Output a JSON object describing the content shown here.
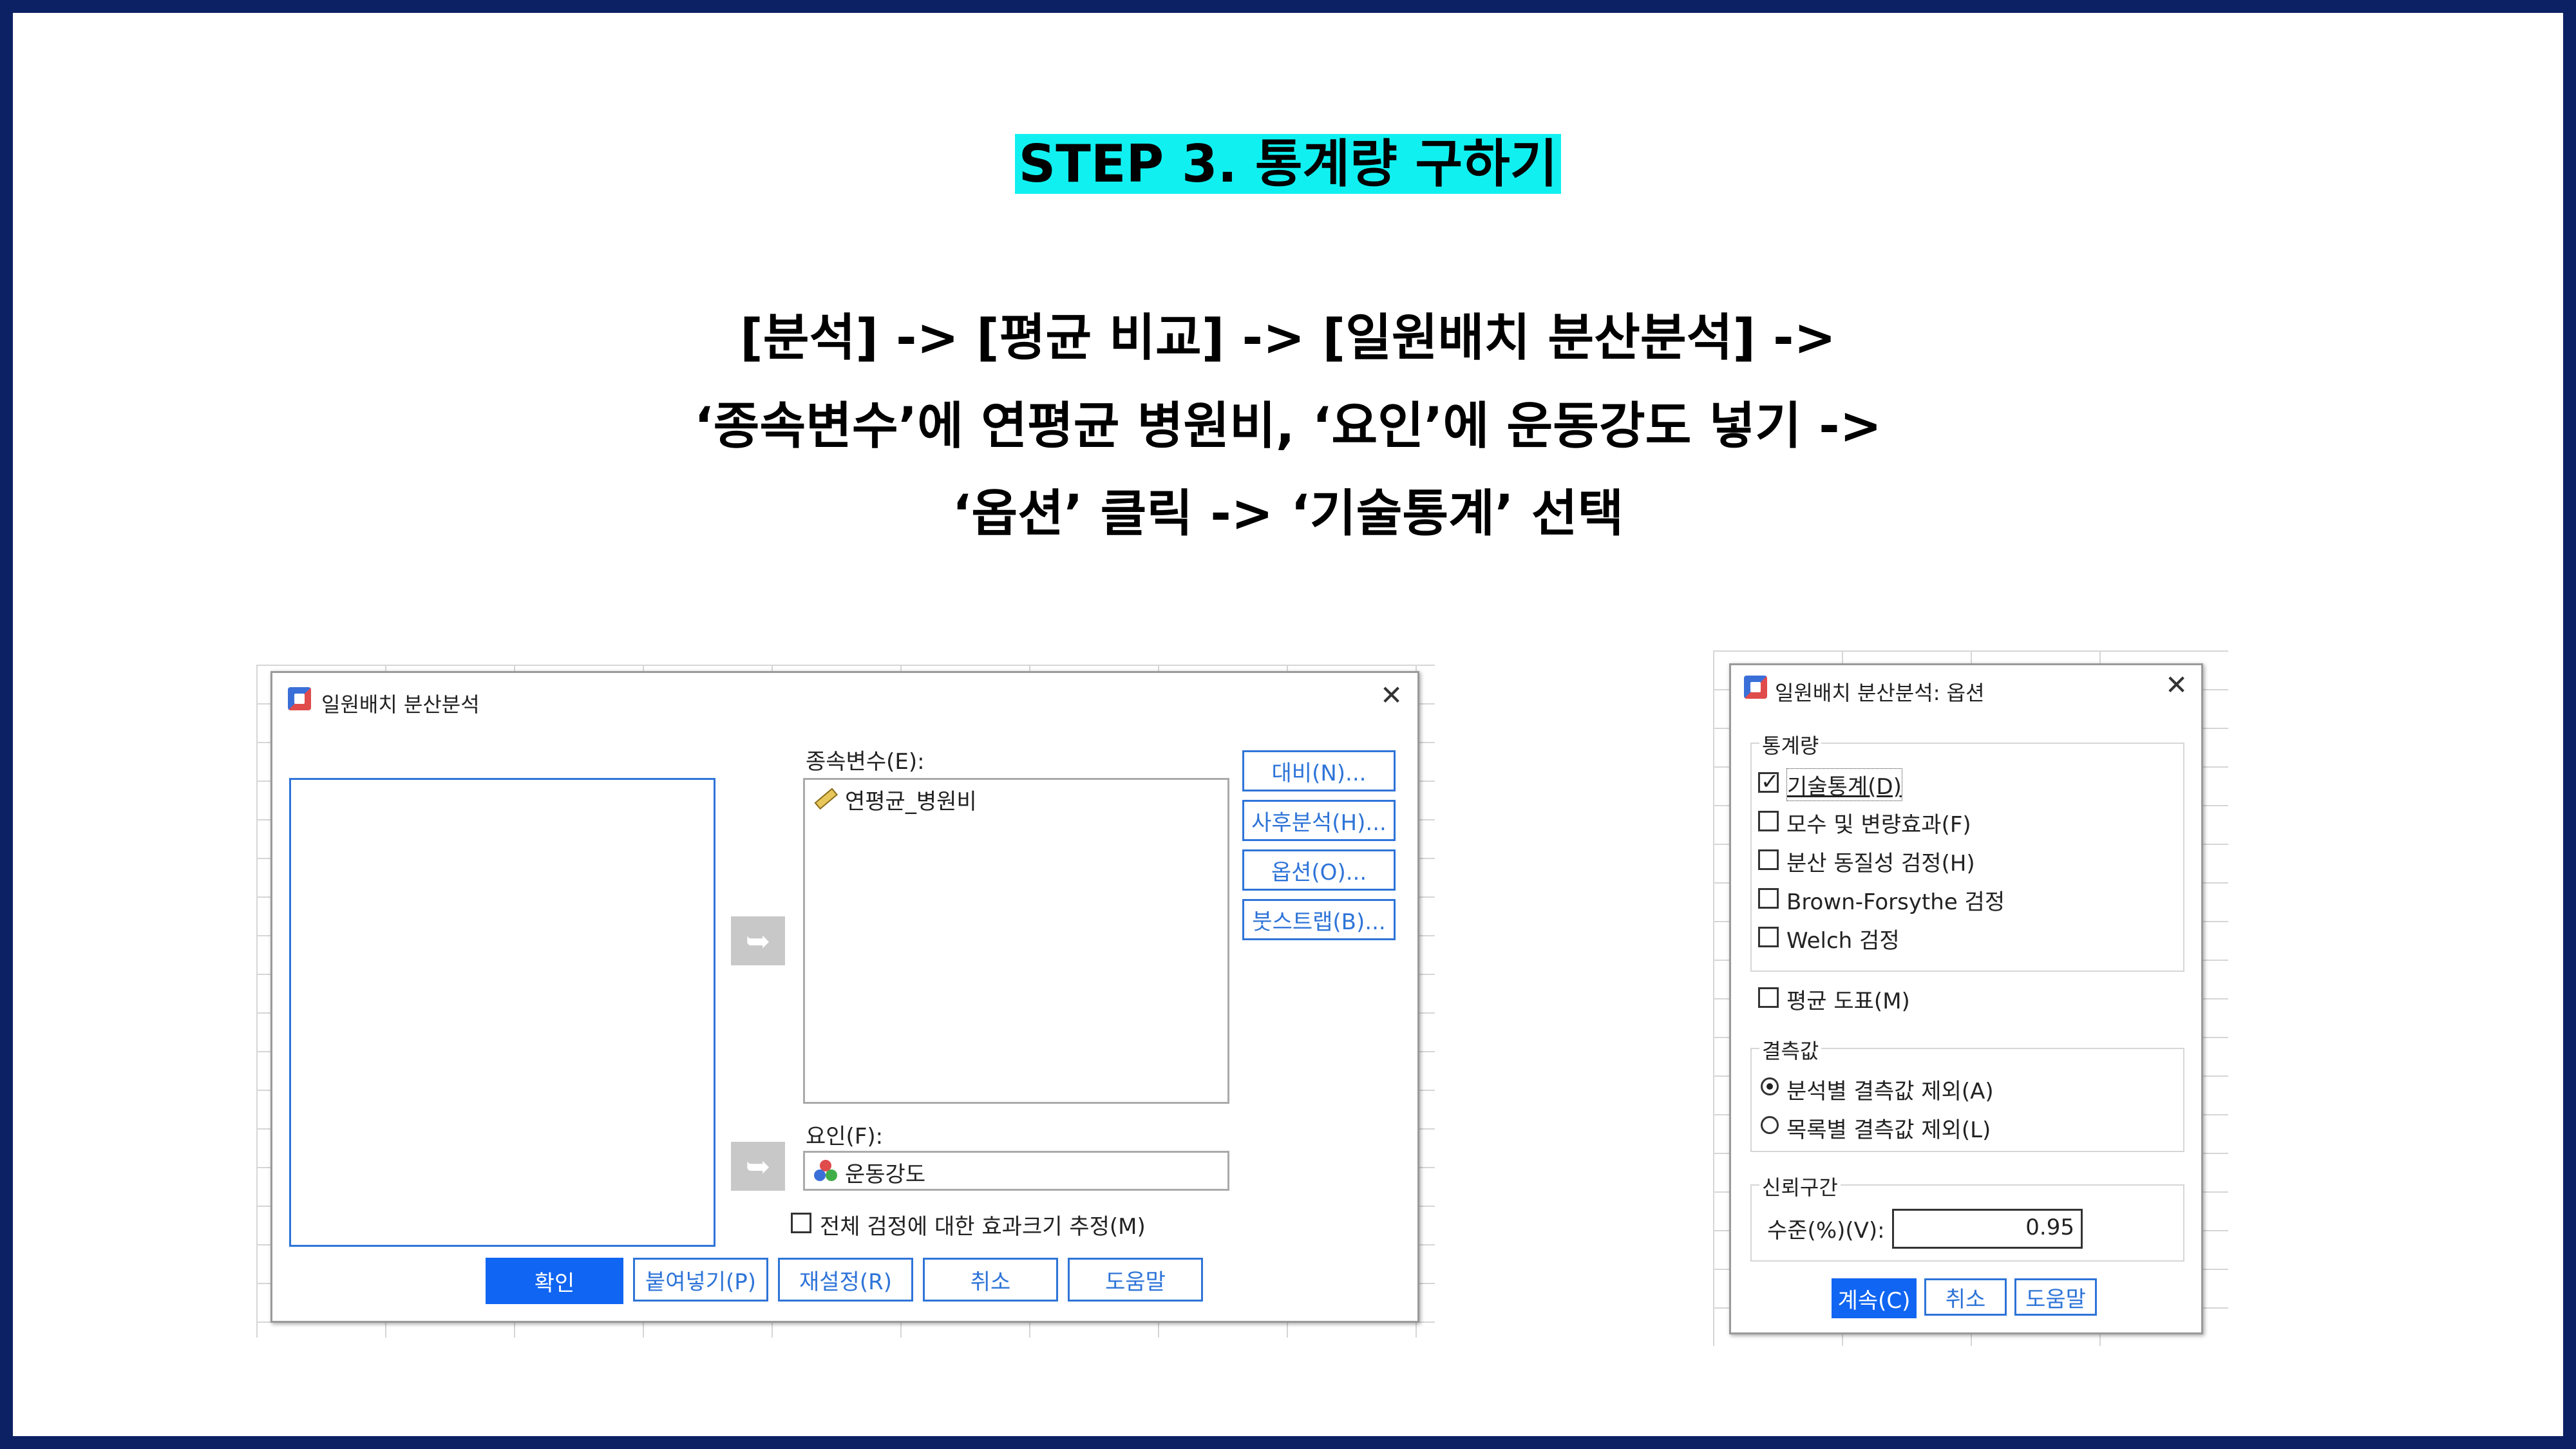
{
  "slide": {
    "title": "STEP 3. 통계량 구하기",
    "instructions": [
      "[분석] -> [평균 비교] -> [일원배치 분산분석] ->",
      "‘종속변수’에 연평균 병원비, ‘요인’에 운동강도 넣기 ->",
      "‘옵션’ 클릭 -> ‘기술통계’ 선택"
    ]
  },
  "anova_dialog": {
    "title": "일원배치 분산분석",
    "dependent_label": "종속변수(E):",
    "dependent_var": "연평균_병원비",
    "factor_label": "요인(F):",
    "factor_var": "운동강도",
    "side_buttons": [
      "대비(N)...",
      "사후분석(H)...",
      "옵션(O)...",
      "붓스트랩(B)..."
    ],
    "effect_size_label": "전체 검정에 대한 효과크기 추정(M)",
    "effect_size_checked": false,
    "bottom_buttons": [
      "확인",
      "붙여넣기(P)",
      "재설정(R)",
      "취소",
      "도움말"
    ]
  },
  "options_dialog": {
    "title": "일원배치 분산분석: 옵션",
    "stats_group": "통계량",
    "stats_options": [
      {
        "label": "기술통계(D)",
        "checked": true
      },
      {
        "label": "모수 및 변량효과(F)",
        "checked": false
      },
      {
        "label": "분산 동질성 검정(H)",
        "checked": false
      },
      {
        "label": "Brown-Forsythe 검정",
        "checked": false
      },
      {
        "label": "Welch 검정",
        "checked": false
      }
    ],
    "means_plot": {
      "label": "평균 도표(M)",
      "checked": false
    },
    "missing_group": "결측값",
    "missing_options": [
      {
        "label": "분석별 결측값 제외(A)",
        "selected": true
      },
      {
        "label": "목록별 결측값 제외(L)",
        "selected": false
      }
    ],
    "ci_group": "신뢰구간",
    "ci_label": "수준(%)(V):",
    "ci_value": "0.95",
    "buttons": [
      "계속(C)",
      "취소",
      "도움말"
    ]
  },
  "colors": {
    "border": "#0c2163",
    "highlight": "#11f0f0",
    "accent": "#1065f2"
  }
}
